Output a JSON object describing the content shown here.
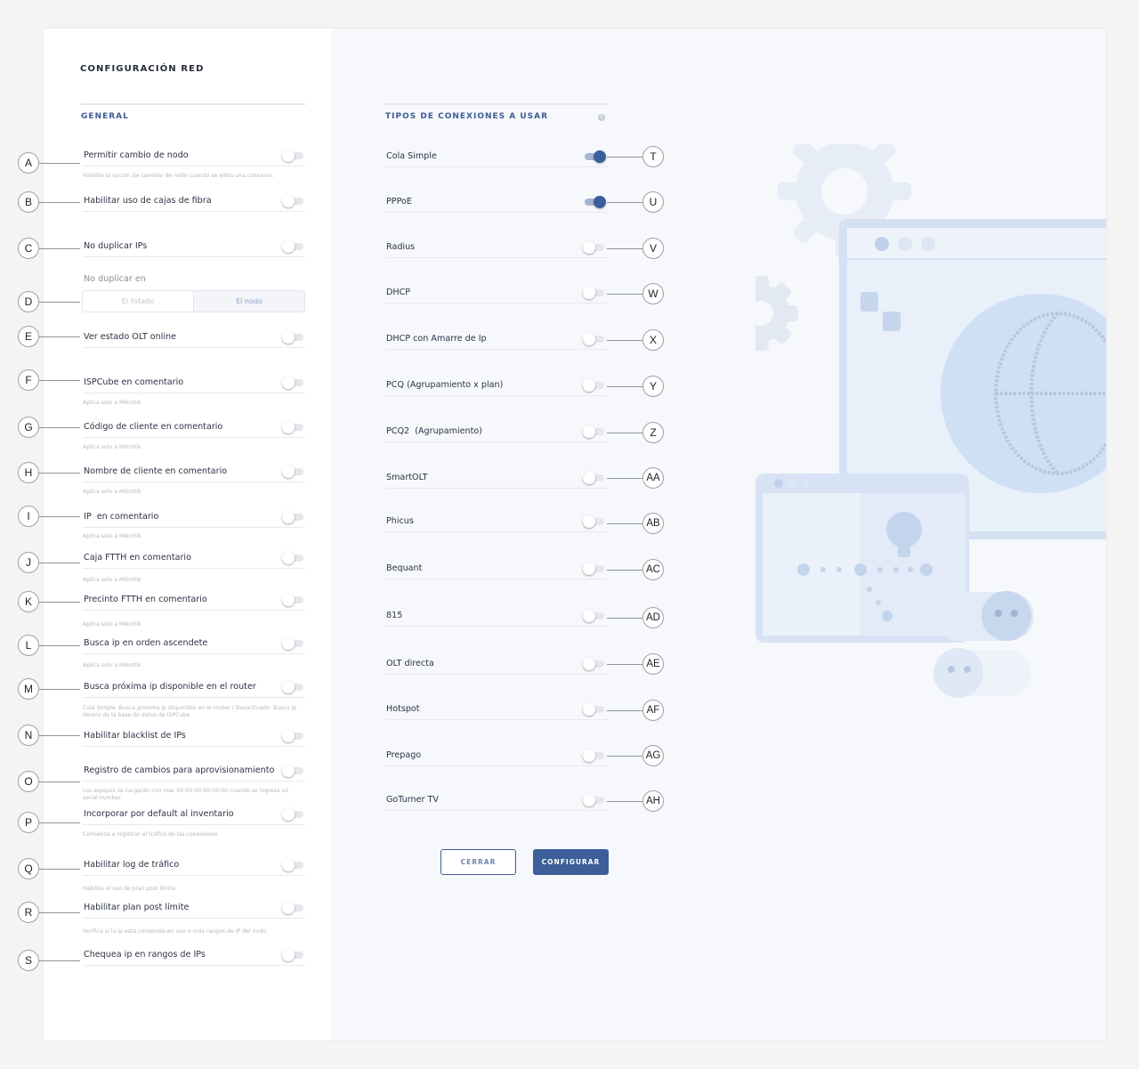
{
  "title": "CONFIGURACIÓN RED",
  "general": {
    "heading": "GENERAL",
    "rows": [
      {
        "label": "Permitir cambio de nodo",
        "hint": "Habilita la opción de cambiar de nodo cuando se edita una conexion.",
        "on": false
      },
      {
        "label": "Habilitar uso de cajas de fibra",
        "hint": "",
        "on": false
      },
      {
        "label": "No duplicar IPs",
        "hint": "",
        "on": false
      },
      {
        "label": "Ver estado OLT online",
        "hint": "",
        "on": false
      },
      {
        "label": "ISPCube en comentario",
        "hint": "Aplica solo a Mikrotik",
        "on": false
      },
      {
        "label": "Código de cliente en comentario",
        "hint": "Aplica solo a Mikrotik",
        "on": false
      },
      {
        "label": "Nombre de cliente en comentario",
        "hint": "Aplica solo a Mikrotik",
        "on": false
      },
      {
        "label": "IP  en comentario",
        "hint": "Aplica solo a Mikrotik",
        "on": false
      },
      {
        "label": "Caja FTTH en comentario",
        "hint": "Aplica solo a Mikrotik",
        "on": false
      },
      {
        "label": "Precinto FTTH en comentario",
        "hint": "Aplica solo a Mikrotik",
        "on": false
      },
      {
        "label": "Busca ip en orden ascendete",
        "hint": "Aplica solo a Mikrotik",
        "on": false
      },
      {
        "label": "Busca próxima ip disponible en el router",
        "hint": "Cola Simple. Busca próxima ip disponible en el router / Desactivado: Busca ip dentro de la base de datos de ISPCube",
        "on": false
      },
      {
        "label": "Habilitar blacklist de IPs",
        "hint": "",
        "on": false
      },
      {
        "label": "Registro de cambios para aprovisionamiento",
        "hint": "Disponible solo para consultas por api",
        "on": false
      },
      {
        "label": "Incorporar por default al inventario",
        "hint": "Los equipos se cargarán con mac 00:00:00:00:00:00 cuando se ingresa un serial number",
        "on": false
      },
      {
        "label": "Habilitar log de tráfico",
        "hint": "Comienza a registrar el tráfico de las conexiones",
        "on": false
      },
      {
        "label": "Habilitar plan post límite",
        "hint": "Habilita el uso de plan post límite",
        "on": false
      },
      {
        "label": "Chequea ip en rangos de IPs",
        "hint": "Verifica si la ip está contenida en uno o más rangos de IP del nodo.",
        "on": false
      }
    ],
    "duplicate": {
      "label": "No duplicar en",
      "options": [
        "El listado",
        "El nodo"
      ],
      "selected": "El nodo"
    }
  },
  "tipos": {
    "heading": "TIPOS DE CONEXIONES A USAR",
    "info_icon": "i",
    "rows": [
      {
        "label": "Cola Simple",
        "on": true
      },
      {
        "label": "PPPoE",
        "on": true
      },
      {
        "label": "Radius",
        "on": false
      },
      {
        "label": "DHCP",
        "on": false
      },
      {
        "label": "DHCP con Amarre de Ip",
        "on": false
      },
      {
        "label": "PCQ (Agrupamiento x plan)",
        "on": false
      },
      {
        "label": "PCQ2  (Agrupamiento)",
        "on": false
      },
      {
        "label": "SmartOLT",
        "on": false
      },
      {
        "label": "Phicus",
        "on": false
      },
      {
        "label": "Bequant",
        "on": false
      },
      {
        "label": "815",
        "on": false
      },
      {
        "label": "OLT directa",
        "on": false
      },
      {
        "label": "Hotspot",
        "on": false
      },
      {
        "label": "Prepago",
        "on": false
      },
      {
        "label": "GoTurner TV",
        "on": false
      }
    ]
  },
  "buttons": {
    "close": "CERRAR",
    "configure": "CONFIGURAR"
  },
  "callouts": {
    "left": [
      "A",
      "B",
      "C",
      "D",
      "E",
      "F",
      "G",
      "H",
      "I",
      "J",
      "K",
      "L",
      "M",
      "N",
      "O",
      "P",
      "Q",
      "R",
      "S"
    ],
    "right": [
      "T",
      "U",
      "V",
      "W",
      "X",
      "Y",
      "Z",
      "AA",
      "AB",
      "AC",
      "AD",
      "AE",
      "AF",
      "AG",
      "AH"
    ]
  },
  "colors": {
    "accent": "#3c5f9a",
    "panel": "#f6f8fc",
    "illustration": "#dde7f5"
  }
}
